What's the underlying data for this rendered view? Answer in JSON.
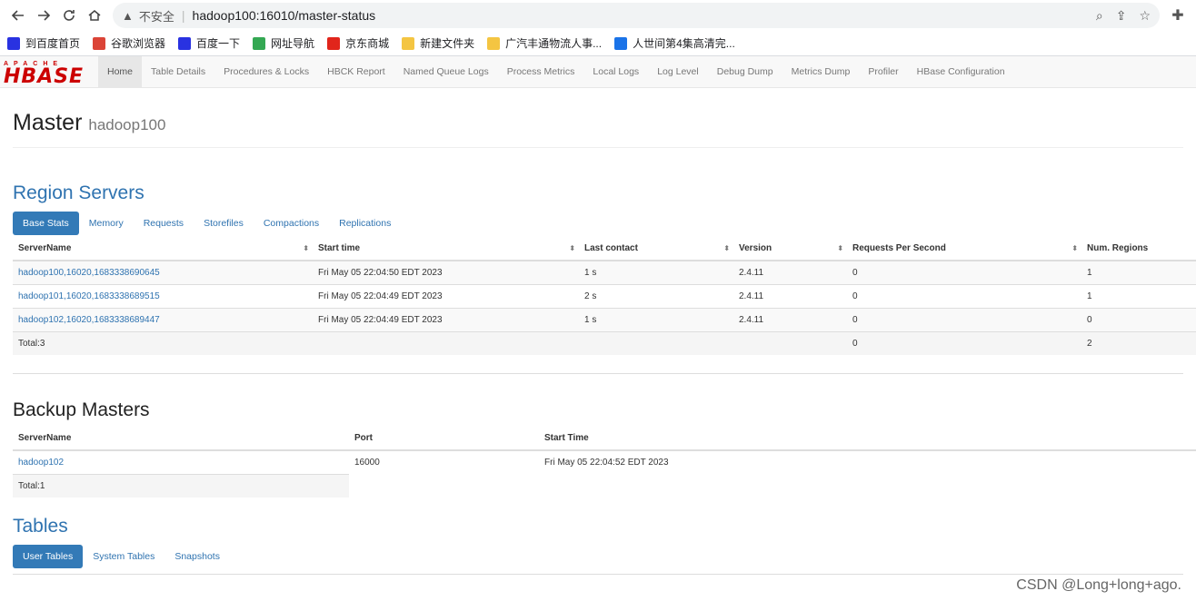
{
  "browser": {
    "security_label": "不安全",
    "url": "hadoop100:16010/master-status",
    "bookmarks": [
      {
        "label": "到百度首页",
        "icon": "baidu-icon",
        "color": "#2932e1"
      },
      {
        "label": "谷歌浏览器",
        "icon": "chrome-icon",
        "color": "#db4437"
      },
      {
        "label": "百度一下",
        "icon": "baidu-icon",
        "color": "#2932e1"
      },
      {
        "label": "网址导航",
        "icon": "nav-icon",
        "color": "#34a853"
      },
      {
        "label": "京东商城",
        "icon": "jd-icon",
        "color": "#e1251b"
      },
      {
        "label": "新建文件夹",
        "icon": "folder-icon",
        "color": "#f4c542"
      },
      {
        "label": "广汽丰通物流人事...",
        "icon": "folder-icon",
        "color": "#f4c542"
      },
      {
        "label": "人世间第4集高清完...",
        "icon": "video-icon",
        "color": "#1a73e8"
      }
    ]
  },
  "hbase": {
    "logo_top": "APACHE",
    "logo_main": "HBASE",
    "nav": [
      {
        "label": "Home",
        "active": true
      },
      {
        "label": "Table Details"
      },
      {
        "label": "Procedures & Locks"
      },
      {
        "label": "HBCK Report"
      },
      {
        "label": "Named Queue Logs"
      },
      {
        "label": "Process Metrics"
      },
      {
        "label": "Local Logs"
      },
      {
        "label": "Log Level"
      },
      {
        "label": "Debug Dump"
      },
      {
        "label": "Metrics Dump"
      },
      {
        "label": "Profiler"
      },
      {
        "label": "HBase Configuration"
      }
    ]
  },
  "header": {
    "title": "Master",
    "subtitle": "hadoop100"
  },
  "region_servers": {
    "title": "Region Servers",
    "tabs": [
      "Base Stats",
      "Memory",
      "Requests",
      "Storefiles",
      "Compactions",
      "Replications"
    ],
    "columns": [
      "ServerName",
      "Start time",
      "Last contact",
      "Version",
      "Requests Per Second",
      "Num. Regions"
    ],
    "rows": [
      [
        "hadoop100,16020,1683338690645",
        "Fri May 05 22:04:50 EDT 2023",
        "1 s",
        "2.4.11",
        "0",
        "1"
      ],
      [
        "hadoop101,16020,1683338689515",
        "Fri May 05 22:04:49 EDT 2023",
        "2 s",
        "2.4.11",
        "0",
        "1"
      ],
      [
        "hadoop102,16020,1683338689447",
        "Fri May 05 22:04:49 EDT 2023",
        "1 s",
        "2.4.11",
        "0",
        "0"
      ]
    ],
    "total": {
      "label": "Total:3",
      "requests": "0",
      "regions": "2"
    }
  },
  "backup_masters": {
    "title": "Backup Masters",
    "columns": [
      "ServerName",
      "Port",
      "Start Time"
    ],
    "rows": [
      [
        "hadoop102",
        "16000",
        "Fri May 05 22:04:52 EDT 2023"
      ]
    ],
    "total": "Total:1"
  },
  "tables": {
    "title": "Tables",
    "tabs": [
      "User Tables",
      "System Tables",
      "Snapshots"
    ]
  },
  "watermark": "CSDN @Long+long+ago."
}
